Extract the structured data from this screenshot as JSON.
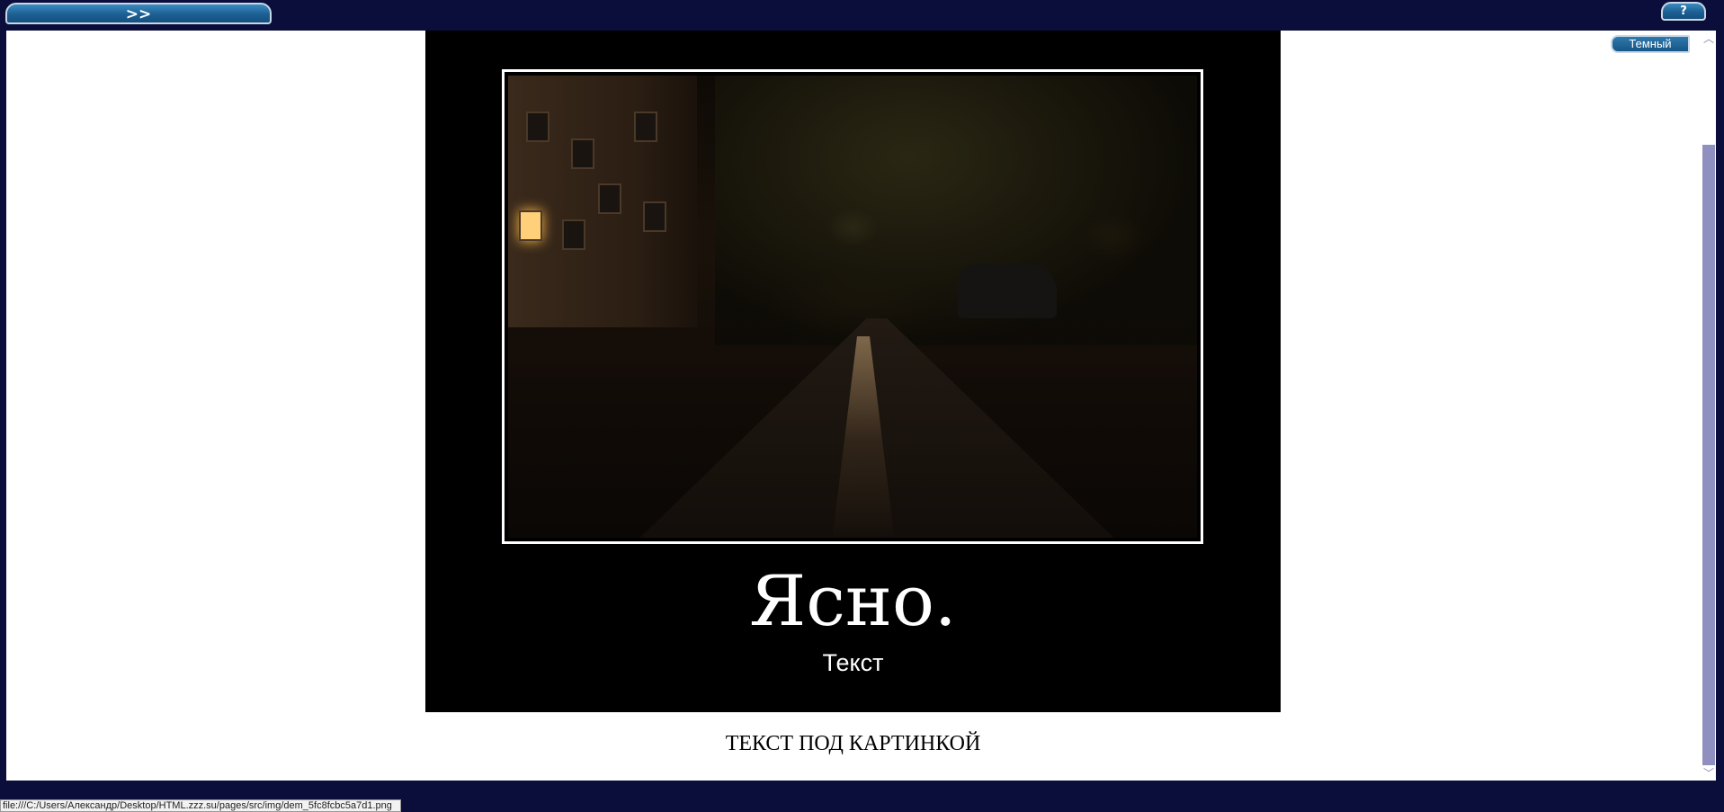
{
  "topbar": {
    "toggle_label": ">>",
    "help_label": "?"
  },
  "content": {
    "theme_button_label": "Темный",
    "demotivator": {
      "title": "Ясно.",
      "subtitle": "Текст"
    },
    "text_below": "ТЕКСТ ПОД КАРТИНКОЙ"
  },
  "statusbar": {
    "url": "file:///C:/Users/Александр/Desktop/HTML.zzz.su/pages/src/img/dem_5fc8fcbc5a7d1.png"
  },
  "colors": {
    "frame_bg": "#0b0e3a",
    "button_blue": "#1c5f93",
    "scroll_thumb": "#9090c0"
  }
}
